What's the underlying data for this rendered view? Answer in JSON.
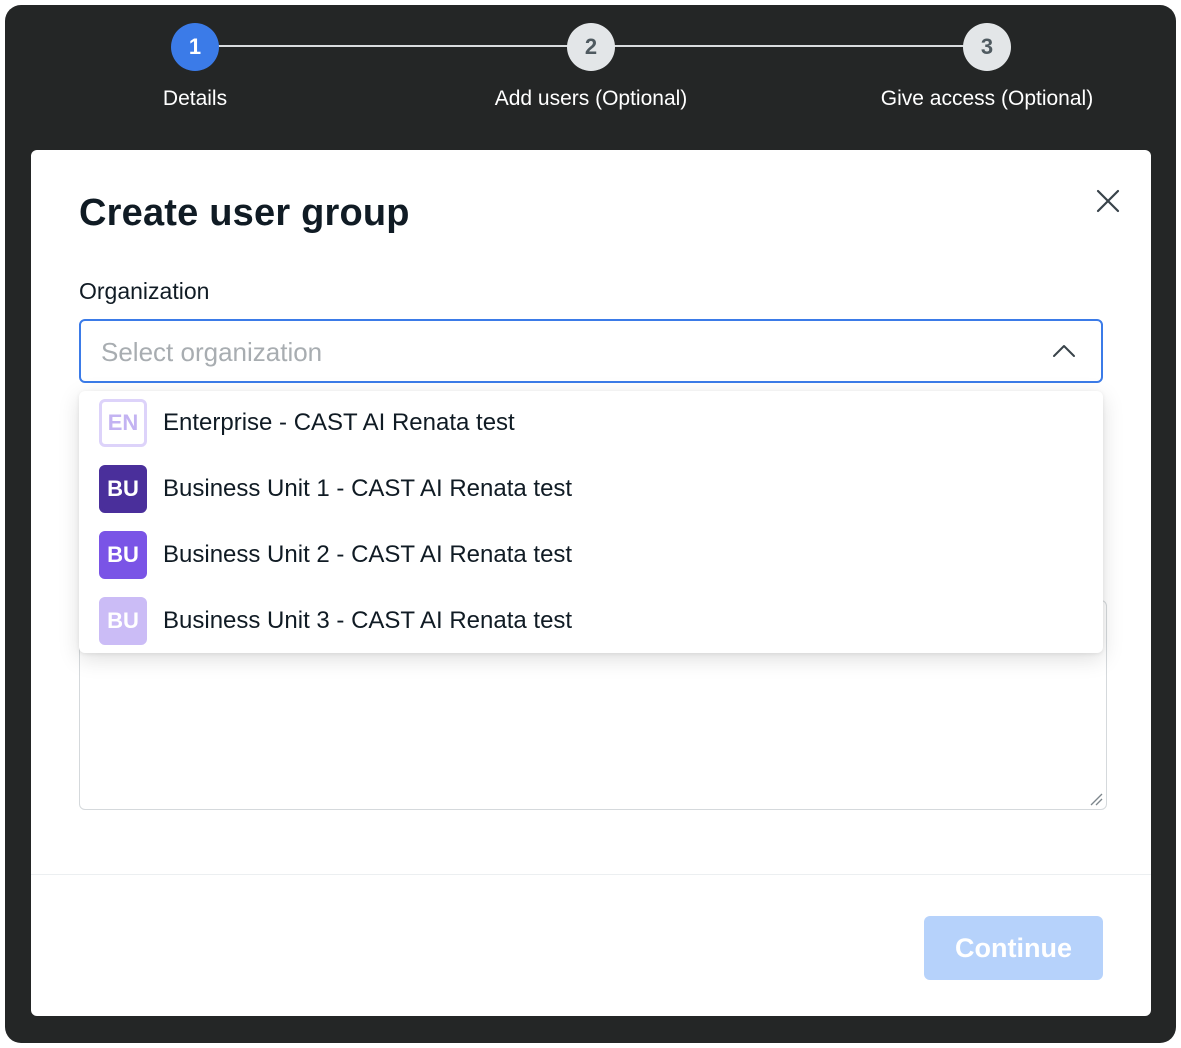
{
  "stepper": {
    "steps": [
      {
        "number": "1",
        "label": "Details",
        "state": "active"
      },
      {
        "number": "2",
        "label": "Add users (Optional)",
        "state": "inactive"
      },
      {
        "number": "3",
        "label": "Give access (Optional)",
        "state": "inactive"
      }
    ]
  },
  "modal": {
    "title": "Create user group",
    "close_icon": "close-icon",
    "organization_field": {
      "label": "Organization",
      "placeholder": "Select organization",
      "chevron_icon": "chevron-up-icon"
    },
    "dropdown": {
      "options": [
        {
          "badge": "EN",
          "label": "Enterprise - CAST AI Renata test",
          "badge_bg": "#ffffff",
          "badge_fg": "#c3b3f2",
          "badge_border": "#ddd3fa"
        },
        {
          "badge": "BU",
          "label": "Business Unit 1 - CAST AI Renata test",
          "badge_bg": "#4a2f9b",
          "badge_fg": "#ffffff",
          "badge_border": "#4a2f9b"
        },
        {
          "badge": "BU",
          "label": "Business Unit 2 - CAST AI Renata test",
          "badge_bg": "#7a54e6",
          "badge_fg": "#ffffff",
          "badge_border": "#7a54e6"
        },
        {
          "badge": "BU",
          "label": "Business Unit 3 - CAST AI Renata test",
          "badge_bg": "#cbbcf6",
          "badge_fg": "#ffffff",
          "badge_border": "#cbbcf6"
        }
      ]
    },
    "continue_label": "Continue"
  },
  "colors": {
    "accent": "#3b7be8",
    "background": "#242626",
    "disabled_button": "#b6d2fb"
  }
}
